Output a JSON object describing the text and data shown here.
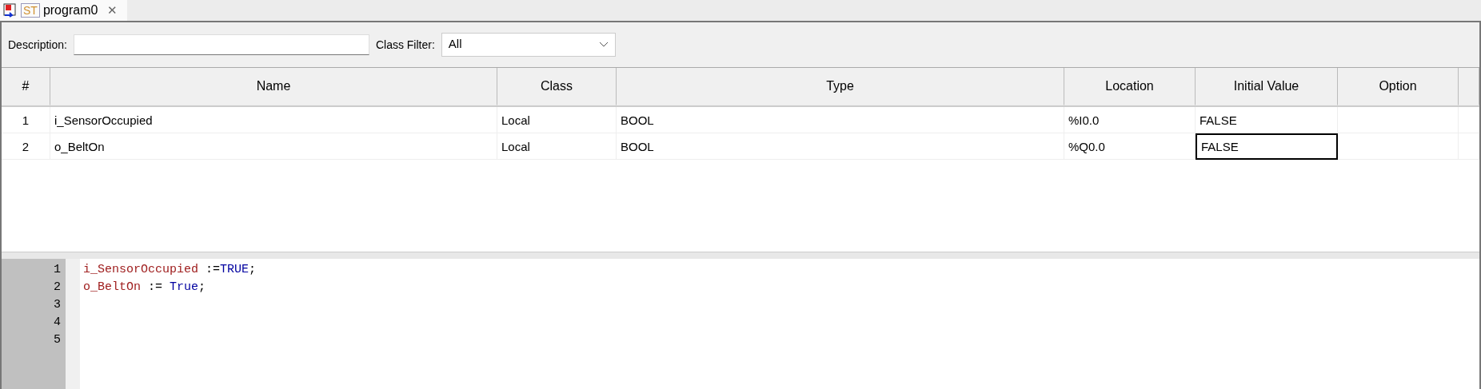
{
  "tabs": [
    {
      "badge": "ST",
      "label": "program0",
      "close": "✕",
      "selected": true
    }
  ],
  "toolbar": {
    "description_label": "Description:",
    "class_filter_label": "Class Filter:",
    "class_filter_value": "All"
  },
  "table": {
    "columns": [
      "#",
      "Name",
      "Class",
      "Type",
      "Location",
      "Initial Value",
      "Option"
    ],
    "rows": [
      {
        "cells": [
          {
            "text": "1",
            "focused": false
          },
          {
            "text": "i_SensorOccupied",
            "focused": false
          },
          {
            "text": "Local",
            "focused": false
          },
          {
            "text": "BOOL",
            "focused": false
          },
          {
            "text": "%I0.0",
            "focused": false
          },
          {
            "text": "FALSE",
            "focused": false
          }
        ]
      },
      {
        "cells": [
          {
            "text": "2",
            "focused": false
          },
          {
            "text": "o_BeltOn",
            "focused": false
          },
          {
            "text": "Local",
            "focused": false
          },
          {
            "text": "BOOL",
            "focused": false
          },
          {
            "text": "%Q0.0",
            "focused": false
          },
          {
            "text": "FALSE",
            "focused": true
          }
        ]
      }
    ]
  },
  "editor": {
    "line_numbers": [
      "1",
      "2",
      "3",
      "4",
      "5"
    ],
    "lines": [
      [
        {
          "kind": "ident",
          "text": "i_SensorOccupied"
        },
        {
          "kind": "op",
          "text": " :="
        },
        {
          "kind": "keyword",
          "text": "TRUE"
        },
        {
          "kind": "op",
          "text": ";"
        }
      ],
      [
        {
          "kind": "ident",
          "text": "o_BeltOn"
        },
        {
          "kind": "op",
          "text": " := "
        },
        {
          "kind": "keyword",
          "text": "True"
        },
        {
          "kind": "op",
          "text": ";"
        }
      ]
    ]
  }
}
